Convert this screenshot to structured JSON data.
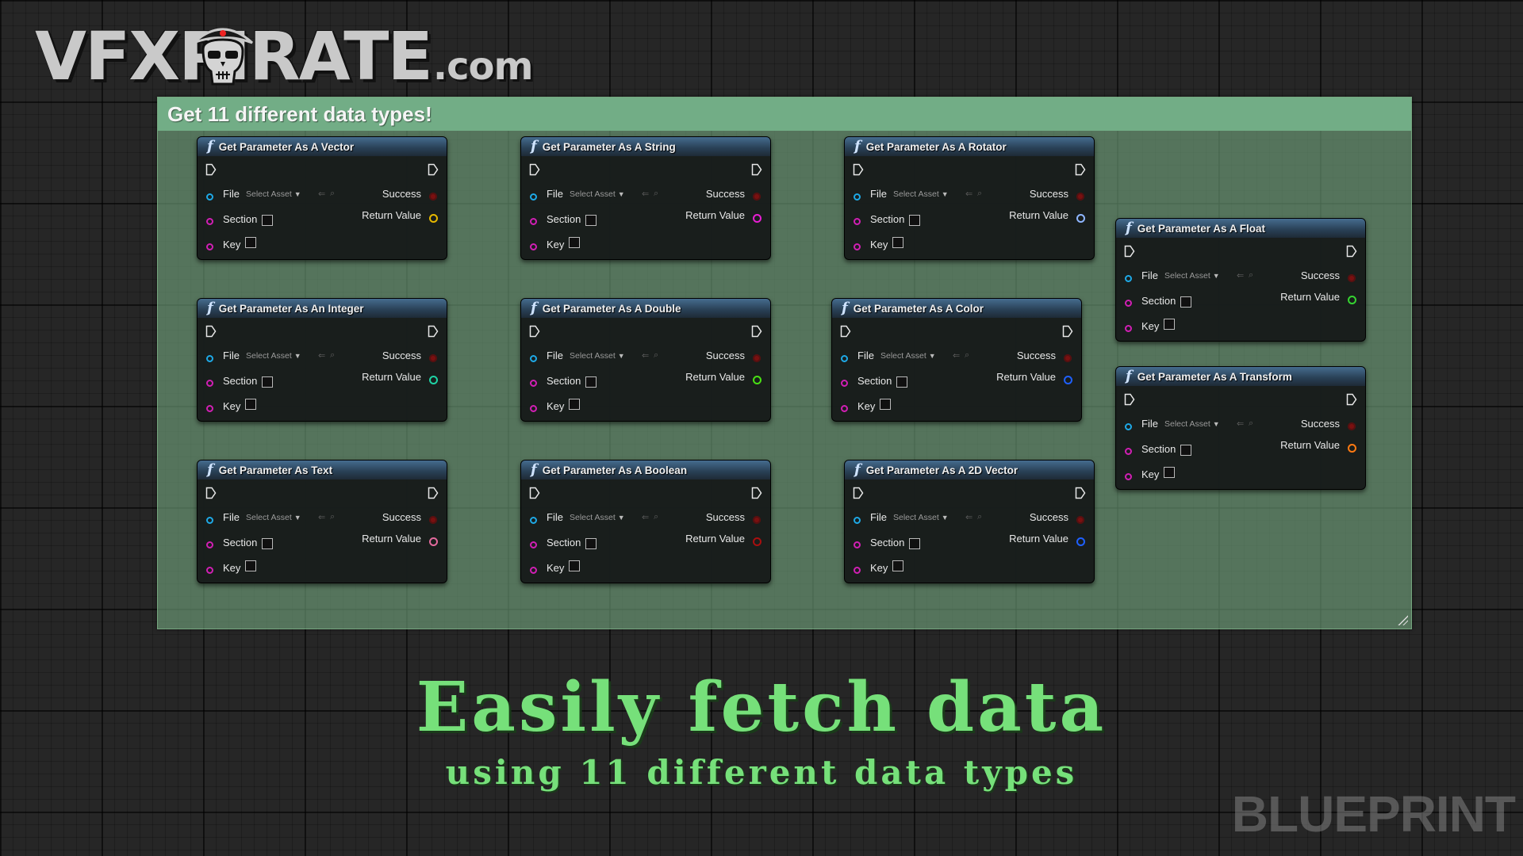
{
  "logo": {
    "main": "VFXPIRATE",
    "domain": ".com"
  },
  "comment": {
    "title": "Get 11 different data types!"
  },
  "nodes": [
    {
      "title": "Get Parameter As A Vector",
      "pin_color": "#e6b800"
    },
    {
      "title": "Get Parameter As A String",
      "pin_color": "#e61ed2"
    },
    {
      "title": "Get Parameter As A Rotator",
      "pin_color": "#8fb6ff"
    },
    {
      "title": "Get Parameter As A Float",
      "pin_color": "#35d431"
    },
    {
      "title": "Get Parameter As An Integer",
      "pin_color": "#1fd3a5"
    },
    {
      "title": "Get Parameter As A Double",
      "pin_color": "#49e014"
    },
    {
      "title": "Get Parameter As A Color",
      "pin_color": "#1f60ff"
    },
    {
      "title": "Get Parameter As A Transform",
      "pin_color": "#ff7a12"
    },
    {
      "title": "Get Parameter As Text",
      "pin_color": "#e36a9d"
    },
    {
      "title": "Get Parameter As A Boolean",
      "pin_color": "#a80f0f"
    },
    {
      "title": "Get Parameter As A 2D Vector",
      "pin_color": "#1f60ff"
    }
  ],
  "pins": {
    "file": "File",
    "section": "Section",
    "key": "Key",
    "success": "Success",
    "return_value": "Return Value",
    "asset_placeholder": "Select Asset"
  },
  "headline": {
    "main": "Easily fetch data",
    "sub": "using 11 different data types"
  },
  "watermark": "BLUEPRINT"
}
